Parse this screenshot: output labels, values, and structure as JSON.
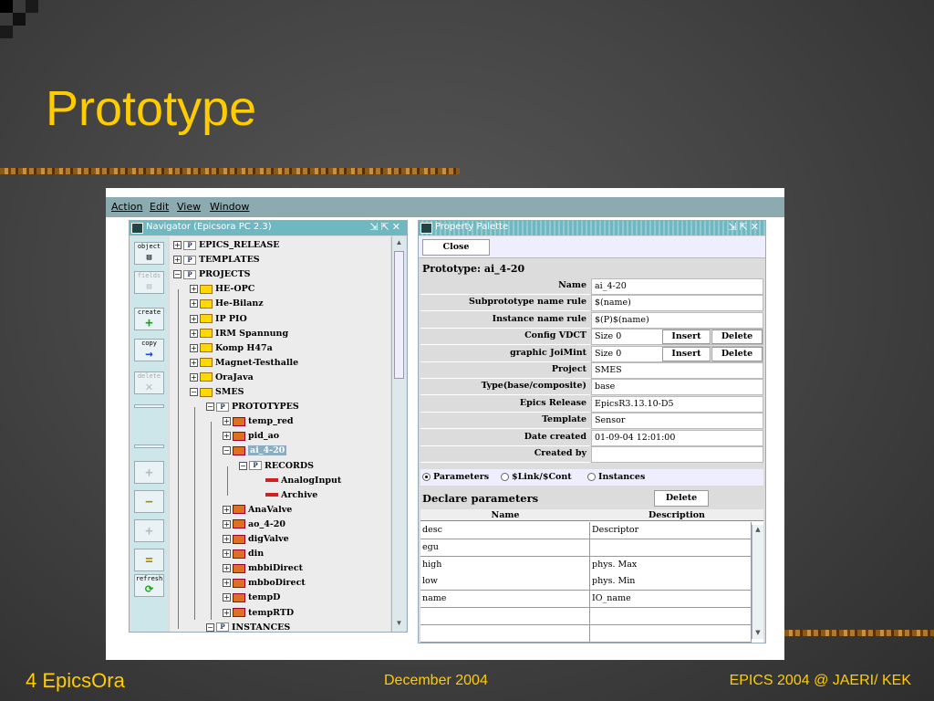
{
  "slide": {
    "title": "Prototype",
    "footer_left": "4 EpicsOra",
    "footer_center": "December 2004",
    "footer_right": "EPICS 2004 @ JAERI/ KEK"
  },
  "menu": [
    "Action",
    "Edit",
    "View",
    "Window"
  ],
  "navigator": {
    "title": "Navigator (Epicsora PC 2.3)",
    "tools": [
      "object",
      "fields",
      "create",
      "copy",
      "delete",
      "refresh"
    ],
    "tree": [
      {
        "label": "EPICS_RELEASE",
        "indent": 0,
        "icon": "p",
        "exp": "+"
      },
      {
        "label": "TEMPLATES",
        "indent": 0,
        "icon": "p",
        "exp": "+"
      },
      {
        "label": "PROJECTS",
        "indent": 0,
        "icon": "p",
        "exp": "-"
      },
      {
        "label": "HE-OPC",
        "indent": 1,
        "icon": "y",
        "exp": "+"
      },
      {
        "label": "He-Bilanz",
        "indent": 1,
        "icon": "y",
        "exp": "+"
      },
      {
        "label": "IP PIO",
        "indent": 1,
        "icon": "y",
        "exp": "+"
      },
      {
        "label": "IRM Spannung",
        "indent": 1,
        "icon": "y",
        "exp": "+"
      },
      {
        "label": "Komp H47a",
        "indent": 1,
        "icon": "y",
        "exp": "+"
      },
      {
        "label": "Magnet-Testhalle",
        "indent": 1,
        "icon": "y",
        "exp": "+"
      },
      {
        "label": "OraJava",
        "indent": 1,
        "icon": "y",
        "exp": "+"
      },
      {
        "label": "SMES",
        "indent": 1,
        "icon": "y",
        "exp": "-"
      },
      {
        "label": "PROTOTYPES",
        "indent": 2,
        "icon": "p",
        "exp": "-"
      },
      {
        "label": "temp_red",
        "indent": 3,
        "icon": "r",
        "exp": "+"
      },
      {
        "label": "pid_ao",
        "indent": 3,
        "icon": "r",
        "exp": "+"
      },
      {
        "label": "ai_4-20",
        "indent": 3,
        "icon": "r",
        "exp": "-",
        "selected": true
      },
      {
        "label": "RECORDS",
        "indent": 4,
        "icon": "p",
        "exp": "-"
      },
      {
        "label": "AnalogInput",
        "indent": 5,
        "icon": "l",
        "exp": ""
      },
      {
        "label": "Archive",
        "indent": 5,
        "icon": "l",
        "exp": ""
      },
      {
        "label": "AnaValve",
        "indent": 3,
        "icon": "r",
        "exp": "+"
      },
      {
        "label": "ao_4-20",
        "indent": 3,
        "icon": "r",
        "exp": "+"
      },
      {
        "label": "digValve",
        "indent": 3,
        "icon": "r",
        "exp": "+"
      },
      {
        "label": "din",
        "indent": 3,
        "icon": "r",
        "exp": "+"
      },
      {
        "label": "mbbiDirect",
        "indent": 3,
        "icon": "r",
        "exp": "+"
      },
      {
        "label": "mbboDirect",
        "indent": 3,
        "icon": "r",
        "exp": "+"
      },
      {
        "label": "tempD",
        "indent": 3,
        "icon": "r",
        "exp": "+"
      },
      {
        "label": "tempRTD",
        "indent": 3,
        "icon": "r",
        "exp": "+"
      },
      {
        "label": "INSTANCES",
        "indent": 2,
        "icon": "p",
        "exp": "-"
      }
    ]
  },
  "palette": {
    "title": "Property Palette",
    "close_label": "Close",
    "prototype_label": "Prototype:  ai_4-20",
    "rows": [
      {
        "label": "Name",
        "value": "ai_4-20"
      },
      {
        "label": "Subprototype name rule",
        "value": "$(name)"
      },
      {
        "label": "Instance name rule",
        "value": "$(P)$(name)"
      },
      {
        "label": "Config VDCT",
        "value": "Size  0",
        "insert": "Insert",
        "delete": "Delete"
      },
      {
        "label": "graphic JoiMint",
        "value": "Size  0",
        "insert": "Insert",
        "delete": "Delete"
      },
      {
        "label": "Project",
        "value": "SMES"
      },
      {
        "label": "Type(base/composite)",
        "value": "base"
      },
      {
        "label": "Epics Release",
        "value": "EpicsR3.13.10-D5"
      },
      {
        "label": "Template",
        "value": "Sensor"
      },
      {
        "label": "Date created",
        "value": "01-09-04 12:01:00"
      },
      {
        "label": "Created by",
        "value": ""
      }
    ],
    "radios": [
      {
        "label": "Parameters",
        "checked": true
      },
      {
        "label": "$Link/$Cont",
        "checked": false
      },
      {
        "label": "Instances",
        "checked": false
      }
    ],
    "declare_label": "Declare parameters",
    "declare_delete": "Delete",
    "columns": [
      "Name",
      "Description"
    ],
    "params": [
      {
        "name": "desc",
        "description": "Descriptor"
      },
      {
        "name": "egu",
        "description": ""
      },
      {
        "name": "high",
        "description": "phys. Max"
      },
      {
        "name": "low",
        "description": "phys. Min"
      },
      {
        "name": "name",
        "description": "IO_name"
      },
      {
        "name": "",
        "description": ""
      },
      {
        "name": "",
        "description": ""
      }
    ]
  }
}
